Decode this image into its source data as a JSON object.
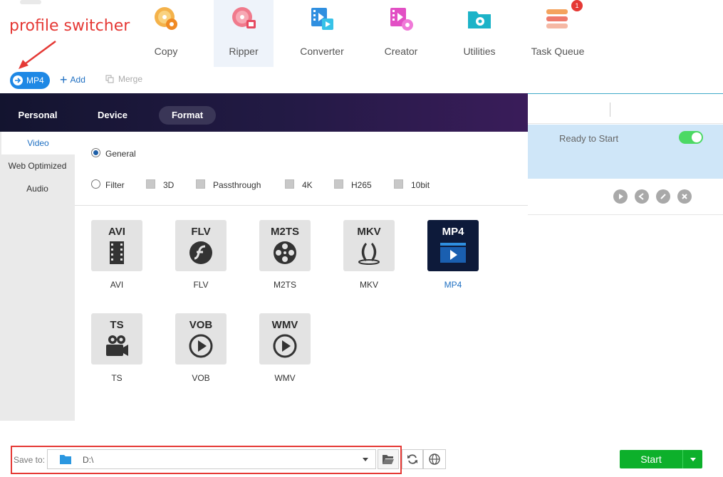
{
  "annotation": {
    "text": "profile switcher"
  },
  "nav": {
    "items": [
      {
        "label": "Copy",
        "icon": "copy-disc-icon"
      },
      {
        "label": "Ripper",
        "icon": "ripper-disc-icon",
        "active": true
      },
      {
        "label": "Converter",
        "icon": "converter-film-icon"
      },
      {
        "label": "Creator",
        "icon": "creator-film-icon"
      },
      {
        "label": "Utilities",
        "icon": "utilities-folder-icon"
      },
      {
        "label": "Task Queue",
        "icon": "task-queue-icon",
        "badge": "1"
      }
    ]
  },
  "toolbar": {
    "profile": "MP4",
    "add_label": "Add",
    "merge_label": "Merge"
  },
  "popup": {
    "tabs": [
      "Personal",
      "Device",
      "Format"
    ],
    "active_tab": "Format",
    "categories": [
      "Video",
      "Web Optimized",
      "Audio"
    ],
    "active_category": "Video",
    "options": {
      "general_label": "General",
      "filter_label": "Filter",
      "filters": [
        "3D",
        "Passthrough",
        "4K",
        "H265",
        "10bit"
      ]
    },
    "formats": [
      {
        "title": "AVI",
        "label": "AVI",
        "icon": "film-strip-icon"
      },
      {
        "title": "FLV",
        "label": "FLV",
        "icon": "flash-icon"
      },
      {
        "title": "M2TS",
        "label": "M2TS",
        "icon": "film-reel-icon"
      },
      {
        "title": "MKV",
        "label": "MKV",
        "icon": "matroska-icon"
      },
      {
        "title": "MP4",
        "label": "MP4",
        "icon": "mp4-play-icon",
        "selected": true
      },
      {
        "title": "TS",
        "label": "TS",
        "icon": "camera-icon"
      },
      {
        "title": "VOB",
        "label": "VOB",
        "icon": "play-circle-icon"
      },
      {
        "title": "WMV",
        "label": "WMV",
        "icon": "play-circle-icon"
      }
    ]
  },
  "task": {
    "status": "Ready to Start",
    "enabled": true
  },
  "bottom": {
    "save_label": "Save to:",
    "path": "D:\\",
    "start_label": "Start"
  },
  "colors": {
    "accent": "#1e88e5",
    "start": "#0db02b",
    "annotation": "#e53935",
    "selected_row": "#cfe6f8"
  }
}
